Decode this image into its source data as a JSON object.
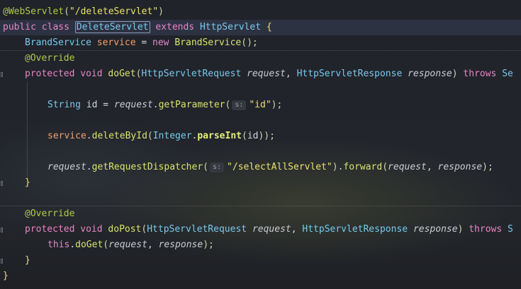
{
  "code": {
    "line1": {
      "annotation": "@WebServlet",
      "open": "(",
      "path": "\"/deleteServlet\"",
      "close": ")"
    },
    "line2": {
      "public": "public",
      "class": "class",
      "name": "DeleteServlet",
      "extends": "extends",
      "parent": "HttpServlet",
      "brace": "{"
    },
    "line3": {
      "type": "BrandService",
      "field": "service",
      "eq": " = ",
      "new": "new",
      "ctor": "BrandService",
      "args": "();"
    },
    "line4": {
      "annotation": "@Override"
    },
    "line5": {
      "protected": "protected",
      "void": "void",
      "method": "doGet",
      "p1type": "HttpServletRequest",
      "p1name": "request",
      "p2type": "HttpServletResponse",
      "p2name": "response",
      "throws": "throws",
      "tail": "Se"
    },
    "line7": {
      "type": "String",
      "var": "id",
      "eq": " = ",
      "obj": "request",
      "call": "getParameter",
      "hint": "s:",
      "arg": "\"id\"",
      "end": ");"
    },
    "line9": {
      "obj": "service",
      "call": "deleteById",
      "cls": "Integer",
      "static": "parseInt",
      "arg": "id",
      "end": "));"
    },
    "line11": {
      "obj": "request",
      "call": "getRequestDispatcher",
      "hint": "s:",
      "arg": "\"/selectAllServlet\"",
      "call2": "forward",
      "a1": "request",
      "a2": "response",
      "end": ");"
    },
    "line12": {
      "brace": "}"
    },
    "line14": {
      "annotation": "@Override"
    },
    "line15": {
      "protected": "protected",
      "void": "void",
      "method": "doPost",
      "p1type": "HttpServletRequest",
      "p1name": "request",
      "p2type": "HttpServletResponse",
      "p2name": "response",
      "throws": "throws",
      "tail": "S"
    },
    "line16": {
      "this": "this",
      "call": "doGet",
      "a1": "request",
      "a2": "response",
      "end": ");"
    },
    "line17": {
      "brace": "}"
    },
    "line18": {
      "brace": "}"
    }
  },
  "colors": {
    "background": "#20232a",
    "keyword": "#e785c5",
    "string": "#e8e26e",
    "class": "#78c9ee",
    "annotation": "#b2c94a",
    "field": "#f2a06a",
    "method": "#d9e36c"
  }
}
